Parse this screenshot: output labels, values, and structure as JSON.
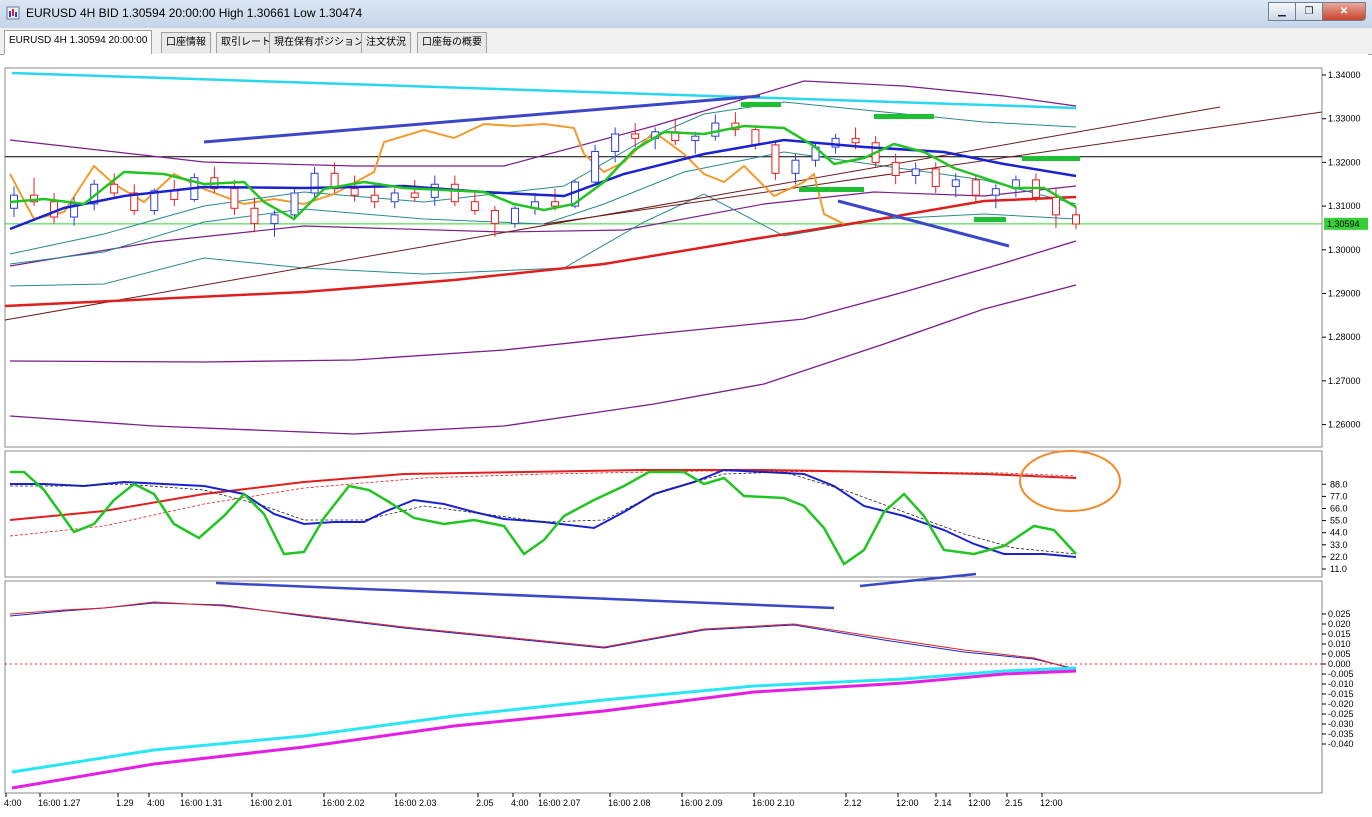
{
  "window": {
    "title": "EURUSD 4H BID 1.30594 20:00:00 High 1.30661 Low 1.30474",
    "minimize_glyph": "▁",
    "restore_glyph": "❐",
    "close_glyph": "✕"
  },
  "tabs": [
    {
      "label": "EURUSD 4H 1.30594 20:00:00"
    },
    {
      "label": "口座情報"
    },
    {
      "label": "取引レート"
    },
    {
      "label": "現在保有ポジション"
    },
    {
      "label": "注文状況"
    },
    {
      "label": "口座毎の概要"
    }
  ],
  "colors": {
    "bull_candle": "#2d3fd8",
    "bear_candle": "#e02020",
    "ma_fast": "#22c422",
    "ma_mid": "#1a22d0",
    "ma_slow": "#e01e1e",
    "orange_line": "#f29a2e",
    "bollinger": "#2a8a8a",
    "envelope": "#7a1e8a",
    "trendline_cyan": "#29d7f0",
    "divergence_line": "#3b46c9",
    "annotation_green": "#1fbf35",
    "circle_orange": "#f28a2e",
    "macd_cyan": "#2ae6f5",
    "macd_magenta": "#e41ee4"
  },
  "price_axis": {
    "ticks": [
      "1.34000",
      "1.33000",
      "1.32000",
      "1.31000",
      "1.30000",
      "1.29000",
      "1.28000",
      "1.27000",
      "1.26000"
    ],
    "current_price": "1.30594"
  },
  "stoch_axis": {
    "ticks": [
      "88.0",
      "77.0",
      "66.0",
      "55.0",
      "44.0",
      "33.0",
      "22.0",
      "11.0"
    ]
  },
  "macd_axis": {
    "ticks": [
      "0.025",
      "0.020",
      "0.015",
      "0.010",
      "0.005",
      "0.000",
      "-0.005",
      "-0.010",
      "-0.015",
      "-0.020",
      "-0.025",
      "-0.030",
      "-0.035",
      "-0.040"
    ]
  },
  "time_axis": {
    "labels": [
      "4:00",
      "16:00 1.27",
      "1.29",
      "4:00",
      "16:00 1.31",
      "16:00 2.01",
      "16:00 2.02",
      "16:00 2.03",
      "2.05",
      "4:00",
      "16:00 2.07",
      "16:00 2.08",
      "16:00 2.09",
      "16:00 2.10",
      "2.12",
      "12:00",
      "2.14",
      "12:00",
      "2.15",
      "12:00"
    ]
  },
  "chart_data": {
    "type": "candlestick",
    "symbol": "EURUSD",
    "timeframe": "4H",
    "last": {
      "bid": 1.30594,
      "time": "20:00:00",
      "high": 1.30661,
      "low": 1.30474
    },
    "ylim": [
      1.255,
      1.345
    ],
    "candles": [
      {
        "o": 1.3095,
        "h": 1.3145,
        "l": 1.3075,
        "c": 1.3125
      },
      {
        "o": 1.3125,
        "h": 1.3165,
        "l": 1.31,
        "c": 1.311
      },
      {
        "o": 1.311,
        "h": 1.313,
        "l": 1.306,
        "c": 1.3075
      },
      {
        "o": 1.3075,
        "h": 1.312,
        "l": 1.3055,
        "c": 1.3105
      },
      {
        "o": 1.3105,
        "h": 1.316,
        "l": 1.309,
        "c": 1.315
      },
      {
        "o": 1.315,
        "h": 1.3175,
        "l": 1.312,
        "c": 1.313
      },
      {
        "o": 1.313,
        "h": 1.315,
        "l": 1.308,
        "c": 1.309
      },
      {
        "o": 1.309,
        "h": 1.314,
        "l": 1.308,
        "c": 1.3135
      },
      {
        "o": 1.3135,
        "h": 1.316,
        "l": 1.31,
        "c": 1.3115
      },
      {
        "o": 1.3115,
        "h": 1.3175,
        "l": 1.311,
        "c": 1.3165
      },
      {
        "o": 1.3165,
        "h": 1.319,
        "l": 1.313,
        "c": 1.314
      },
      {
        "o": 1.314,
        "h": 1.316,
        "l": 1.308,
        "c": 1.3095
      },
      {
        "o": 1.3095,
        "h": 1.312,
        "l": 1.304,
        "c": 1.306
      },
      {
        "o": 1.306,
        "h": 1.309,
        "l": 1.303,
        "c": 1.308
      },
      {
        "o": 1.308,
        "h": 1.314,
        "l": 1.307,
        "c": 1.313
      },
      {
        "o": 1.313,
        "h": 1.319,
        "l": 1.312,
        "c": 1.3175
      },
      {
        "o": 1.3175,
        "h": 1.32,
        "l": 1.313,
        "c": 1.314
      },
      {
        "o": 1.314,
        "h": 1.317,
        "l": 1.311,
        "c": 1.3125
      },
      {
        "o": 1.3125,
        "h": 1.315,
        "l": 1.3095,
        "c": 1.311
      },
      {
        "o": 1.311,
        "h": 1.314,
        "l": 1.3095,
        "c": 1.313
      },
      {
        "o": 1.313,
        "h": 1.316,
        "l": 1.311,
        "c": 1.312
      },
      {
        "o": 1.312,
        "h": 1.317,
        "l": 1.31,
        "c": 1.315
      },
      {
        "o": 1.315,
        "h": 1.317,
        "l": 1.31,
        "c": 1.311
      },
      {
        "o": 1.311,
        "h": 1.313,
        "l": 1.308,
        "c": 1.309
      },
      {
        "o": 1.309,
        "h": 1.31,
        "l": 1.303,
        "c": 1.306
      },
      {
        "o": 1.306,
        "h": 1.31,
        "l": 1.305,
        "c": 1.3095
      },
      {
        "o": 1.3095,
        "h": 1.313,
        "l": 1.308,
        "c": 1.311
      },
      {
        "o": 1.311,
        "h": 1.314,
        "l": 1.309,
        "c": 1.31
      },
      {
        "o": 1.31,
        "h": 1.316,
        "l": 1.3095,
        "c": 1.3155
      },
      {
        "o": 1.3155,
        "h": 1.324,
        "l": 1.315,
        "c": 1.3225
      },
      {
        "o": 1.3225,
        "h": 1.328,
        "l": 1.32,
        "c": 1.3265
      },
      {
        "o": 1.3265,
        "h": 1.329,
        "l": 1.3235,
        "c": 1.3255
      },
      {
        "o": 1.3255,
        "h": 1.328,
        "l": 1.323,
        "c": 1.327
      },
      {
        "o": 1.327,
        "h": 1.33,
        "l": 1.324,
        "c": 1.325
      },
      {
        "o": 1.325,
        "h": 1.327,
        "l": 1.322,
        "c": 1.326
      },
      {
        "o": 1.326,
        "h": 1.331,
        "l": 1.325,
        "c": 1.329
      },
      {
        "o": 1.329,
        "h": 1.3315,
        "l": 1.326,
        "c": 1.3275
      },
      {
        "o": 1.3275,
        "h": 1.3285,
        "l": 1.323,
        "c": 1.324
      },
      {
        "o": 1.324,
        "h": 1.325,
        "l": 1.316,
        "c": 1.3175
      },
      {
        "o": 1.3175,
        "h": 1.322,
        "l": 1.315,
        "c": 1.3205
      },
      {
        "o": 1.3205,
        "h": 1.3245,
        "l": 1.319,
        "c": 1.3235
      },
      {
        "o": 1.3235,
        "h": 1.3265,
        "l": 1.322,
        "c": 1.3255
      },
      {
        "o": 1.3255,
        "h": 1.328,
        "l": 1.323,
        "c": 1.3245
      },
      {
        "o": 1.3245,
        "h": 1.326,
        "l": 1.319,
        "c": 1.32
      },
      {
        "o": 1.32,
        "h": 1.322,
        "l": 1.315,
        "c": 1.317
      },
      {
        "o": 1.317,
        "h": 1.32,
        "l": 1.315,
        "c": 1.3185
      },
      {
        "o": 1.3185,
        "h": 1.32,
        "l": 1.313,
        "c": 1.3145
      },
      {
        "o": 1.3145,
        "h": 1.3175,
        "l": 1.312,
        "c": 1.316
      },
      {
        "o": 1.316,
        "h": 1.317,
        "l": 1.311,
        "c": 1.3125
      },
      {
        "o": 1.3125,
        "h": 1.315,
        "l": 1.3095,
        "c": 1.314
      },
      {
        "o": 1.314,
        "h": 1.317,
        "l": 1.312,
        "c": 1.316
      },
      {
        "o": 1.316,
        "h": 1.3175,
        "l": 1.311,
        "c": 1.312
      },
      {
        "o": 1.312,
        "h": 1.314,
        "l": 1.305,
        "c": 1.308
      },
      {
        "o": 1.308,
        "h": 1.31,
        "l": 1.3047,
        "c": 1.3059
      }
    ],
    "stoch_ylim": [
      0,
      100
    ],
    "macd_ylim": [
      -0.042,
      0.028
    ]
  }
}
